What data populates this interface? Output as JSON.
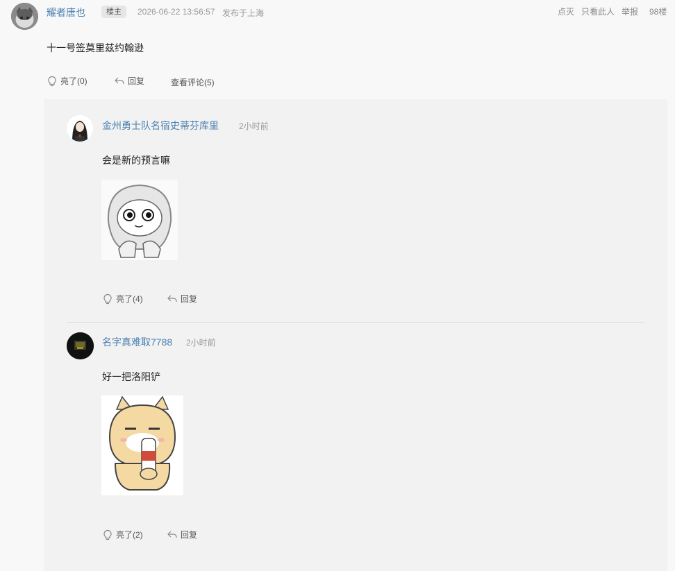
{
  "post": {
    "author": "耀者唐也",
    "badge": "楼主",
    "time": "2026-06-22 13:56:57",
    "location": "发布于上海",
    "links": [
      "点灭",
      "只看此人",
      "举报"
    ],
    "floor": "98楼",
    "content": "十一号签莫里兹约翰逊",
    "like": "亮了(0)",
    "reply": "回复",
    "view_comments": "查看评论(5)"
  },
  "comments": [
    {
      "author": "金州勇士队名宿史蒂芬库里",
      "time": "2小时前",
      "content": "会是新的预言嘛",
      "like": "亮了(4)",
      "reply": "回复"
    },
    {
      "author": "名字真难取7788",
      "time": "2小时前",
      "content": "好一把洛阳铲",
      "like": "亮了(2)",
      "reply": "回复"
    }
  ],
  "icons": {
    "like": "lightbulb-icon",
    "reply": "reply-arrow-icon"
  },
  "colors": {
    "name": "#4a80b0",
    "panel": "#f2f2f2",
    "background": "#f8f8f8"
  }
}
